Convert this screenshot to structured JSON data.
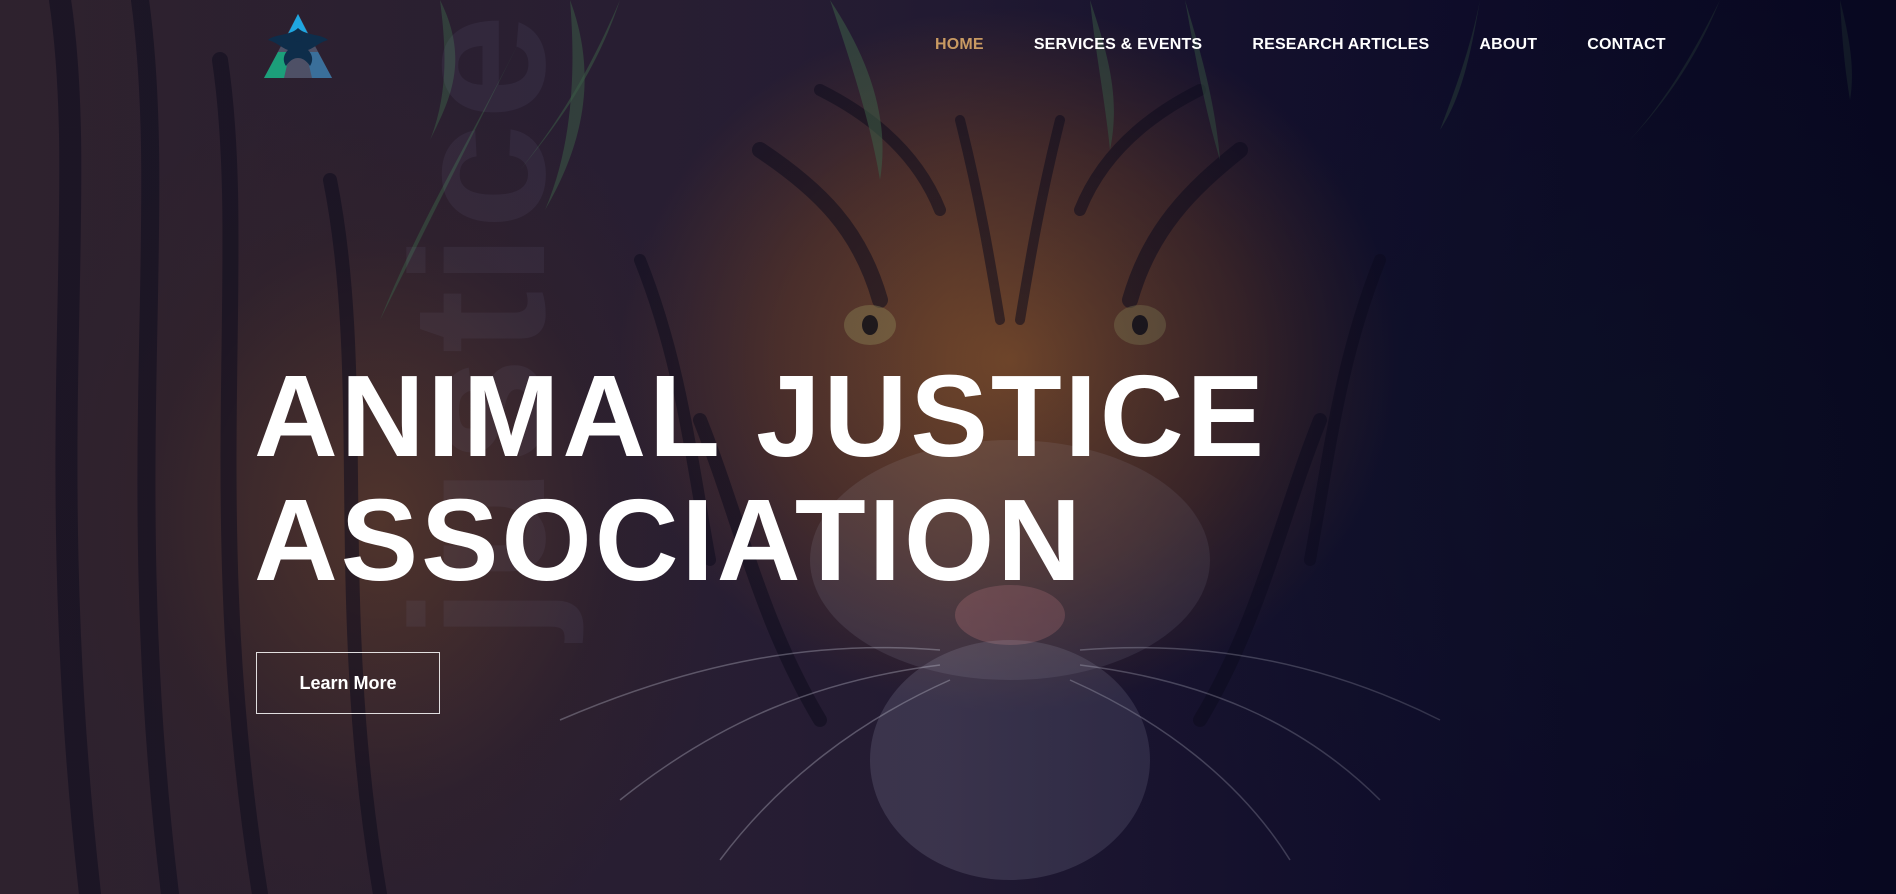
{
  "brand": {
    "logo_icon": "eagle-triangle-logo",
    "colors": {
      "blue": "#1fa6e0",
      "teal": "#1c9f7a",
      "dark": "#0e2d4a"
    }
  },
  "nav": {
    "items": [
      {
        "label": "HOME",
        "active": true
      },
      {
        "label": "SERVICES & EVENTS",
        "active": false
      },
      {
        "label": "RESEARCH ARTICLES",
        "active": false
      },
      {
        "label": "ABOUT",
        "active": false
      },
      {
        "label": "CONTACT",
        "active": false
      }
    ],
    "active_color": "#c99a62"
  },
  "hero": {
    "watermark": "justice",
    "title_line1": "ANIMAL JUSTICE",
    "title_line2": "ASSOCIATION",
    "cta_label": "Learn More"
  }
}
